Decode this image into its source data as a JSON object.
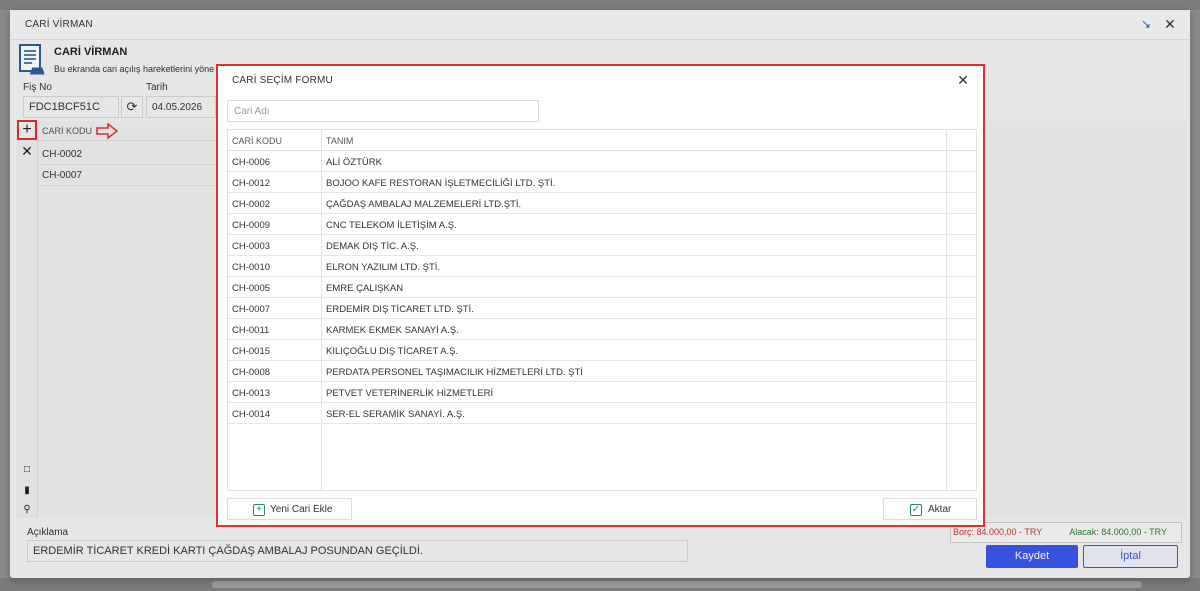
{
  "window": {
    "title": "CARİ VİRMAN",
    "heading": "CARİ VİRMAN",
    "description": "Bu ekranda cari açılış hareketlerini yöne",
    "min_icon": "resize-icon",
    "close_icon": "close-icon"
  },
  "form": {
    "fisno_label": "Fiş No",
    "fisno_value": "FDC1BCF51C",
    "tarih_label": "Tarih",
    "tarih_value": "04.05.2026"
  },
  "grid": {
    "header": "CARİ KODU",
    "rows": [
      "CH-0002",
      "CH-0007"
    ]
  },
  "footer": {
    "aciklama_label": "Açıklama",
    "aciklama_value": "ERDEMİR TİCARET KREDİ KARTI ÇAĞDAŞ AMBALAJ POSUNDAN GEÇİLDİ.",
    "borc": "Borç: 84.000,00 - TRY",
    "alacak": "Alacak: 84.000,00 - TRY",
    "save_label": "Kaydet",
    "cancel_label": "İptal"
  },
  "modal": {
    "title": "CARİ SEÇİM FORMU",
    "search_placeholder": "Cari Adı",
    "columns": [
      "CARİ KODU",
      "TANIM"
    ],
    "rows": [
      {
        "code": "CH-0006",
        "name": "ALİ ÖZTÜRK"
      },
      {
        "code": "CH-0012",
        "name": "BOJOO KAFE RESTORAN İŞLETMECİLİĞİ LTD. ŞTİ."
      },
      {
        "code": "CH-0002",
        "name": "ÇAĞDAŞ AMBALAJ MALZEMELERİ LTD.ŞTİ."
      },
      {
        "code": "CH-0009",
        "name": "CNC TELEKOM İLETİŞİM A.Ş."
      },
      {
        "code": "CH-0003",
        "name": "DEMAK DIŞ TİC. A.Ş."
      },
      {
        "code": "CH-0010",
        "name": "ELRON YAZILIM LTD. ŞTİ."
      },
      {
        "code": "CH-0005",
        "name": "EMRE ÇALIŞKAN"
      },
      {
        "code": "CH-0007",
        "name": "ERDEMİR DIŞ TİCARET LTD. ŞTİ."
      },
      {
        "code": "CH-0011",
        "name": "KARMEK EKMEK SANAYİ A.Ş."
      },
      {
        "code": "CH-0015",
        "name": "KILIÇOĞLU DIŞ TİCARET A.Ş."
      },
      {
        "code": "CH-0008",
        "name": "PERDATA PERSONEL TAŞIMACILIK HİZMETLERİ LTD. ŞTİ"
      },
      {
        "code": "CH-0013",
        "name": "PETVET VETERİNERLİK HİZMETLERİ"
      },
      {
        "code": "CH-0014",
        "name": "SER-EL SERAMİK SANAYİ. A.Ş."
      }
    ],
    "new_button": "Yeni Cari Ekle",
    "transfer_button": "Aktar"
  }
}
